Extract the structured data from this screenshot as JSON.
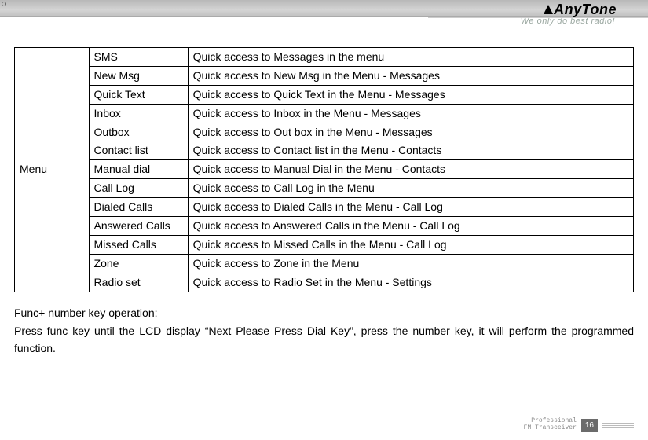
{
  "header": {
    "brand": "AnyTone",
    "slogan": "We only do best radio!"
  },
  "table": {
    "category": "Menu",
    "rows": [
      {
        "name": "SMS",
        "desc": "Quick access to Messages in the menu"
      },
      {
        "name": "New Msg",
        "desc": "Quick access to New Msg in the Menu - Messages"
      },
      {
        "name": "Quick Text",
        "desc": "Quick access to Quick Text in the Menu - Messages"
      },
      {
        "name": "Inbox",
        "desc": "Quick access to Inbox in the Menu - Messages"
      },
      {
        "name": "Outbox",
        "desc": "Quick access to Out box in the Menu - Messages"
      },
      {
        "name": "Contact list",
        "desc": "Quick access to Contact list in the Menu - Contacts"
      },
      {
        "name": "Manual dial",
        "desc": "Quick access to Manual Dial in the Menu - Contacts"
      },
      {
        "name": "Call Log",
        "desc": "Quick access to Call Log in the Menu"
      },
      {
        "name": "Dialed Calls",
        "desc": "Quick access to Dialed Calls in the Menu - Call Log"
      },
      {
        "name": "Answered Calls",
        "desc": "Quick access to Answered Calls in the Menu - Call Log"
      },
      {
        "name": "Missed Calls",
        "desc": "Quick access to Missed Calls in the Menu - Call Log"
      },
      {
        "name": "Zone",
        "desc": "Quick access to Zone in the Menu"
      },
      {
        "name": "Radio set",
        "desc": "Quick access to Radio Set in the Menu - Settings"
      }
    ]
  },
  "body": {
    "p1": "Func+ number key operation:",
    "p2": "Press func key until the LCD display “Next Please Press Dial Key”, press the number key, it will perform the programmed function."
  },
  "footer": {
    "line1": "Professional",
    "line2": "FM Transceiver",
    "page": "16"
  }
}
